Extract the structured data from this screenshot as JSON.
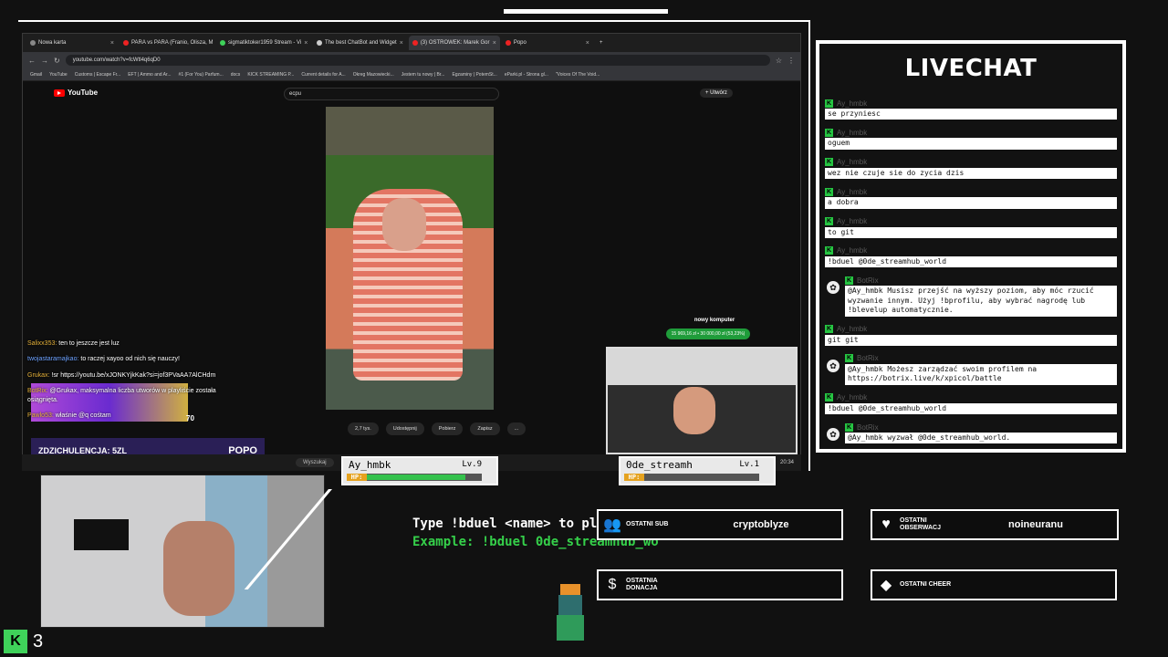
{
  "browser": {
    "tabs": [
      {
        "label": "Nowa karta"
      },
      {
        "label": "PARA vs PARA (Franio, Olisza, M"
      },
      {
        "label": "sigmatiktoker1959 Stream - Vi"
      },
      {
        "label": "The best ChatBot and Widget"
      },
      {
        "label": "(3) OSTROWEK: Marek Gor"
      },
      {
        "label": "Popo"
      }
    ],
    "url": "youtube.com/watch?v=fcWtl4q6qD0",
    "bookmarks": [
      "Gmail",
      "YouTube",
      "Customs | Escape Fr...",
      "EFT | Ammo and Ar...",
      "#1 (For You) Parfum...",
      "docs",
      "KICK STREAMING P...",
      "Current details for A...",
      "Okreg Mazowiecki...",
      "Jestem tu nowy | Br...",
      "Egzaminy | PotemSt...",
      "eParki.pl - Strona gl...",
      "\"Voices Of The Void..."
    ]
  },
  "youtube": {
    "logo": "YouTube",
    "search_value": "ecpu",
    "create_label": "Utwórz",
    "actions": [
      "2,7 tys.",
      "Udostępnij",
      "Pobierz",
      "Zapisz",
      "..."
    ],
    "money_title": "nowy komputer",
    "money_value": "15 969,16 zł • 30 000,00 zł (53,23%)"
  },
  "stream_chat": [
    {
      "user": "Salixx353:",
      "text": "ten to jeszcze jest luz",
      "color": "orange"
    },
    {
      "user": "twojastaramajkao:",
      "text": "to raczej xayoo od nich się nauczy!",
      "color": "blue"
    },
    {
      "user": "Grukax:",
      "text": "!sr https://youtu.be/xJONKYjkKak?si=jof3PVaAA7AlCHdm",
      "color": "orange"
    },
    {
      "user": "BotRix:",
      "text": "@Grukax, maksymalna liczba utworów w playliście została osiągnięta.",
      "color": "orange"
    },
    {
      "user": "Pawlo53:",
      "text": "właśnie @q cośtam",
      "color": "orange"
    }
  ],
  "promo": {
    "headline": "ZDZICHULENCJA: 5ZL",
    "name": "POPO",
    "value": "70"
  },
  "taskbar": {
    "search": "Wyszukaj",
    "time": "20:34"
  },
  "hp": [
    {
      "name": "Ay_hmbk",
      "level": "Lv.9",
      "hp_label": "HP:",
      "fraction": 0.86
    },
    {
      "name": "0de_streamh",
      "level": "Lv.1",
      "hp_label": "HP:",
      "fraction": 0.0
    }
  ],
  "livechat": {
    "title": "LIVECHAT",
    "messages": [
      {
        "user": "Ay_hmbk",
        "text": "se przyniesc",
        "bot": false
      },
      {
        "user": "Ay_hmbk",
        "text": "oguem",
        "bot": false
      },
      {
        "user": "Ay_hmbk",
        "text": "wez nie czuje sie do zycia dzis",
        "bot": false
      },
      {
        "user": "Ay_hmbk",
        "text": "a dobra",
        "bot": false
      },
      {
        "user": "Ay_hmbk",
        "text": "to git",
        "bot": false
      },
      {
        "user": "Ay_hmbk",
        "text": "!bduel @0de_streamhub_world",
        "bot": false
      },
      {
        "user": "BotRix",
        "text": "@Ay_hmbk Musisz przejść na wyższy poziom, aby móc rzucić wyzwanie innym. Użyj !bprofilu, aby wybrać nagrodę lub !blevelup automatycznie.",
        "bot": true
      },
      {
        "user": "Ay_hmbk",
        "text": "git git",
        "bot": false
      },
      {
        "user": "BotRix",
        "text": "@Ay_hmbk Możesz zarządzać swoim profilem na https://botrix.live/k/xpicol/battle",
        "bot": true
      },
      {
        "user": "Ay_hmbk",
        "text": "!bduel @0de_streamhub_world",
        "bot": false
      },
      {
        "user": "BotRix",
        "text": "@Ay_hmbk wyzwał @0de_streamhub_world.",
        "bot": true
      }
    ]
  },
  "bduel": {
    "line1": "Type !bduel <name> to play",
    "line2": "Example: !bduel 0de_streamhub_wo"
  },
  "widgets": [
    {
      "icon": "👥",
      "label": "OSTATNI SUB",
      "value": "cryptoblyze"
    },
    {
      "icon": "♥",
      "label": "OSTATNI OBSERWACJ",
      "value": "noineuranu"
    },
    {
      "icon": "$",
      "label": "OSTATNIA DONACJA",
      "value": ""
    },
    {
      "icon": "◆",
      "label": "OSTATNI CHEER",
      "value": ""
    }
  ],
  "kick": {
    "logo": "K",
    "viewers": "3"
  }
}
